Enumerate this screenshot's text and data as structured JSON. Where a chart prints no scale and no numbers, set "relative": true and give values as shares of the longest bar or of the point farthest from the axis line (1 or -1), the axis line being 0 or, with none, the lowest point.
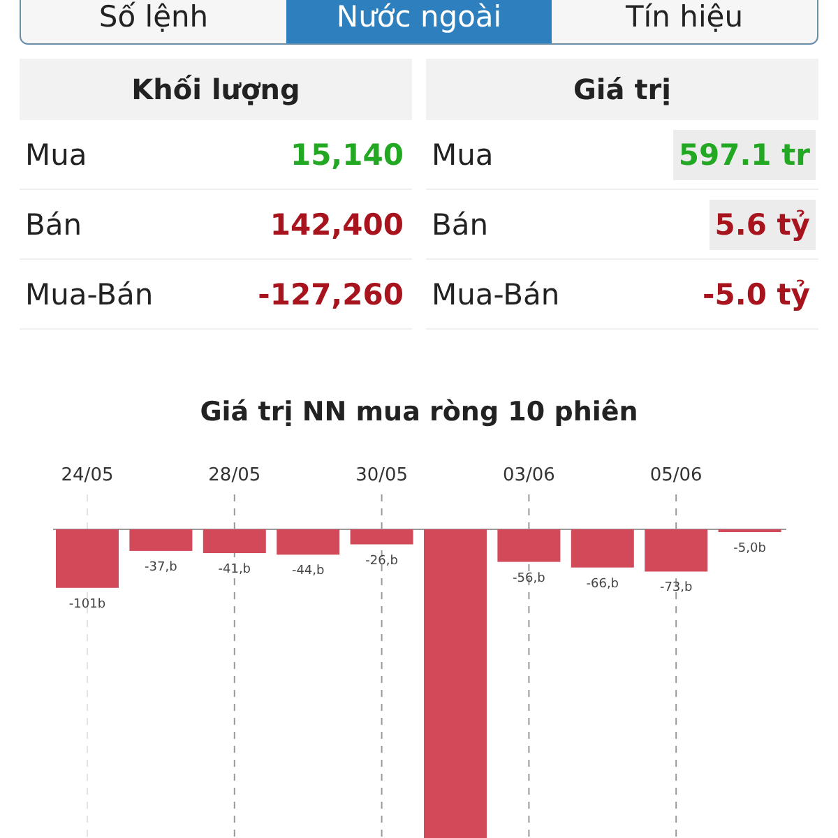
{
  "tabs": [
    {
      "label": "Số lệnh",
      "selected": false
    },
    {
      "label": "Nước ngoài",
      "selected": true
    },
    {
      "label": "Tín hiệu",
      "selected": false
    }
  ],
  "panels": [
    {
      "title": "Khối lượng",
      "rows": [
        {
          "label": "Mua",
          "value": "15,140",
          "color": "#22a822",
          "highlighted": false
        },
        {
          "label": "Bán",
          "value": "142,400",
          "color": "#a8141e",
          "highlighted": false
        },
        {
          "label": "Mua-Bán",
          "value": "-127,260",
          "color": "#a8141e",
          "highlighted": false
        }
      ]
    },
    {
      "title": "Giá trị",
      "rows": [
        {
          "label": "Mua",
          "value": "597.1 tr",
          "color": "#22a822",
          "highlighted": true
        },
        {
          "label": "Bán",
          "value": "5.6 tỷ",
          "color": "#a8141e",
          "highlighted": true
        },
        {
          "label": "Mua-Bán",
          "value": "-5.0 tỷ",
          "color": "#a8141e",
          "highlighted": false
        }
      ]
    }
  ],
  "chart_data": {
    "type": "bar",
    "title": "Giá trị NN mua ròng 10 phiên",
    "categories": [
      "24/05",
      null,
      "28/05",
      null,
      "30/05",
      null,
      "03/06",
      null,
      "05/06",
      null
    ],
    "series": [
      {
        "color": "#d24a5a",
        "values": [
          -0.187,
          -0.069,
          -0.076,
          -0.081,
          -0.048,
          -1,
          -0.104,
          -0.122,
          -0.135,
          -0.009
        ]
      }
    ],
    "grid": true,
    "relative": true,
    "value_labels": [
      "-101b",
      "-37,b",
      "-41,b",
      "-44,b",
      "-26,b",
      null,
      "-56,b",
      "-66,b",
      "-73,b",
      "-5,0b"
    ]
  }
}
